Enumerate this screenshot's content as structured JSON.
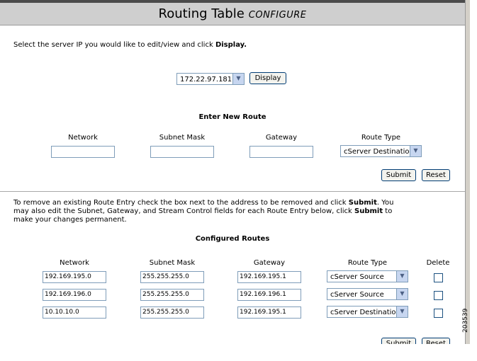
{
  "header": {
    "title": "Routing Table",
    "subtitle": "CONFIGURE"
  },
  "server_select": {
    "instruction_prefix": "Select the server IP you would like to edit/view and click ",
    "instruction_bold": "Display.",
    "selected_ip": "172.22.97.181",
    "display_button": "Display"
  },
  "new_route": {
    "heading": "Enter New Route",
    "columns": [
      "Network",
      "Subnet Mask",
      "Gateway",
      "Route Type"
    ],
    "route_type_value": "cServer Destination",
    "submit": "Submit",
    "reset": "Reset"
  },
  "configured": {
    "instr_1": "To remove an existing Route Entry check the box next to the address to be removed and click ",
    "instr_1b": "Submit",
    "instr_2": ". You",
    "instr_3": "may also edit the Subnet, Gateway, and Stream Control fields for each Route Entry below, click ",
    "instr_3b": "Submit",
    "instr_4": " to",
    "instr_5": "make your changes permanent.",
    "heading": "Configured Routes",
    "columns": [
      "Network",
      "Subnet Mask",
      "Gateway",
      "Route Type",
      "Delete"
    ],
    "rows": [
      {
        "network": "192.169.195.0",
        "mask": "255.255.255.0",
        "gateway": "192.169.195.1",
        "type": "cServer Source"
      },
      {
        "network": "192.169.196.0",
        "mask": "255.255.255.0",
        "gateway": "192.169.196.1",
        "type": "cServer Source"
      },
      {
        "network": "10.10.10.0",
        "mask": "255.255.255.0",
        "gateway": "192.169.195.1",
        "type": "cServer Destination"
      }
    ],
    "submit": "Submit",
    "reset": "Reset"
  },
  "figure_id": "203539"
}
